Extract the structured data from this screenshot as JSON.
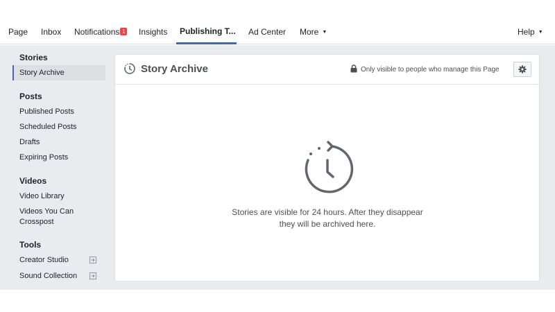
{
  "topnav": {
    "items": [
      {
        "label": "Page"
      },
      {
        "label": "Inbox"
      },
      {
        "label": "Notifications",
        "badge": "1"
      },
      {
        "label": "Insights"
      },
      {
        "label": "Publishing T..."
      },
      {
        "label": "Ad Center"
      },
      {
        "label": "More"
      }
    ],
    "help": "Help",
    "active_tab": "Publishing T...",
    "accent_color": "#4267b2",
    "badge_color": "#fa3e3e"
  },
  "sidebar": {
    "sections": [
      {
        "heading": "Stories",
        "items": [
          {
            "label": "Story Archive",
            "selected": true
          }
        ]
      },
      {
        "heading": "Posts",
        "items": [
          {
            "label": "Published Posts"
          },
          {
            "label": "Scheduled Posts"
          },
          {
            "label": "Drafts"
          },
          {
            "label": "Expiring Posts"
          }
        ]
      },
      {
        "heading": "Videos",
        "items": [
          {
            "label": "Video Library"
          },
          {
            "label": "Videos You Can Crosspost"
          }
        ]
      },
      {
        "heading": "Tools",
        "items": [
          {
            "label": "Creator Studio",
            "icon": "external-link-icon"
          },
          {
            "label": "Sound Collection",
            "icon": "external-link-icon"
          }
        ]
      }
    ]
  },
  "panel": {
    "title": "Story Archive",
    "title_icon": "clock-history-icon",
    "visibility_text": "Only visible to people who manage this Page",
    "visibility_icon": "lock-icon",
    "settings_icon": "gear-icon",
    "empty_message": "Stories are visible for 24 hours. After they disappear they will be archived here.",
    "empty_icon": "clock-history-icon"
  }
}
